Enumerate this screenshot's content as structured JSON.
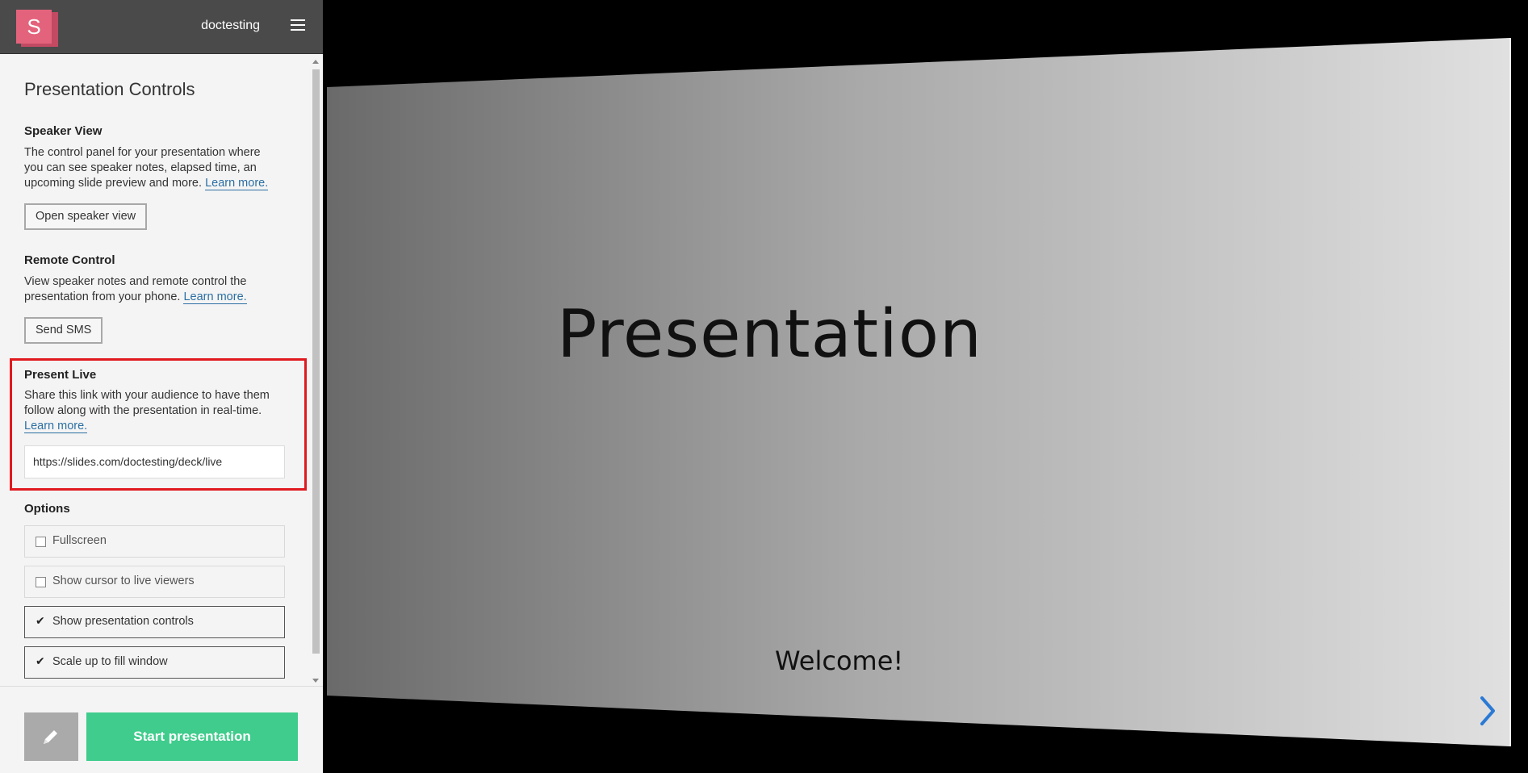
{
  "app": {
    "logo_letter": "S",
    "username": "doctesting"
  },
  "panel": {
    "title": "Presentation Controls",
    "speaker_view": {
      "title": "Speaker View",
      "description": "The control panel for your presentation where you can see speaker notes, elapsed time, an upcoming slide preview and more.",
      "learn_more": "Learn more.",
      "button_label": "Open speaker view"
    },
    "remote_control": {
      "title": "Remote Control",
      "description": "View speaker notes and remote control the presentation from your phone.",
      "learn_more": "Learn more.",
      "button_label": "Send SMS"
    },
    "present_live": {
      "title": "Present Live",
      "description": "Share this link with your audience to have them follow along with the presentation in real-time.",
      "learn_more": "Learn more.",
      "url": "https://slides.com/doctesting/deck/live"
    },
    "options": {
      "title": "Options",
      "fullscreen": {
        "label": "Fullscreen",
        "checked": false
      },
      "show_cursor": {
        "label": "Show cursor to live viewers",
        "checked": false
      },
      "show_controls": {
        "label": "Show presentation controls",
        "checked": true
      },
      "scale_up": {
        "label": "Scale up to fill window",
        "checked": true
      }
    }
  },
  "footer": {
    "start_label": "Start presentation",
    "edit_icon": "pencil-icon"
  },
  "slide": {
    "title": "Presentation",
    "subtitle": "Welcome!"
  },
  "colors": {
    "accent_green": "#3fcc8c",
    "logo_pink": "#e4637c",
    "highlight_red": "#e0191e",
    "link_blue": "#2c6fa3",
    "nav_arrow": "#2a7ad5"
  }
}
